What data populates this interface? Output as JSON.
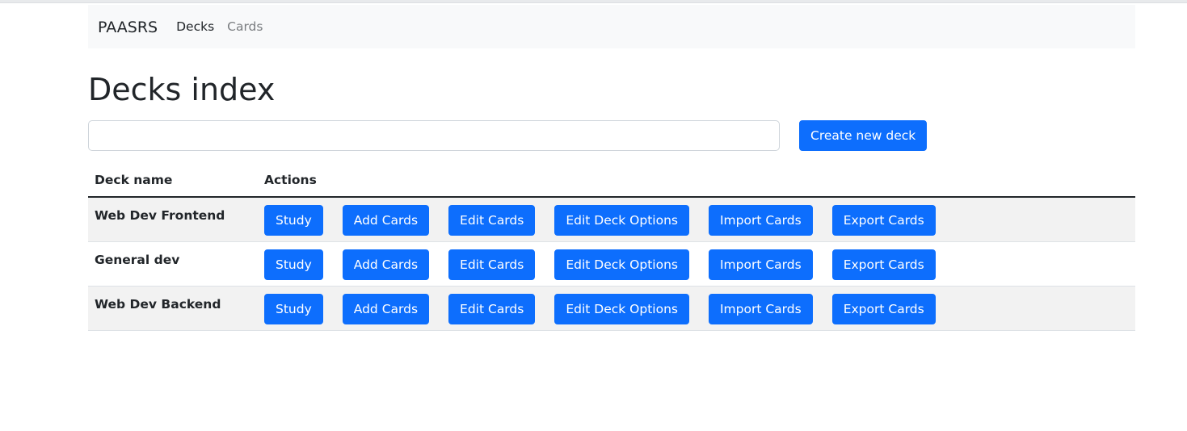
{
  "navbar": {
    "brand": "PAASRS",
    "links": [
      {
        "label": "Decks",
        "active": true
      },
      {
        "label": "Cards",
        "active": false
      }
    ]
  },
  "page": {
    "title": "Decks index"
  },
  "search": {
    "value": "",
    "placeholder": ""
  },
  "create_button": "Create new deck",
  "table": {
    "headers": [
      "Deck name",
      "Actions"
    ],
    "action_labels": [
      "Study",
      "Add Cards",
      "Edit Cards",
      "Edit Deck Options",
      "Import Cards",
      "Export Cards"
    ],
    "rows": [
      {
        "name": "Web Dev Frontend"
      },
      {
        "name": "General dev"
      },
      {
        "name": "Web Dev Backend"
      }
    ]
  },
  "colors": {
    "primary": "#0d6efd",
    "navbar_bg": "#f8f9fa",
    "stripe": "#f2f2f2",
    "text": "#212529",
    "muted": "#7a7d80"
  }
}
